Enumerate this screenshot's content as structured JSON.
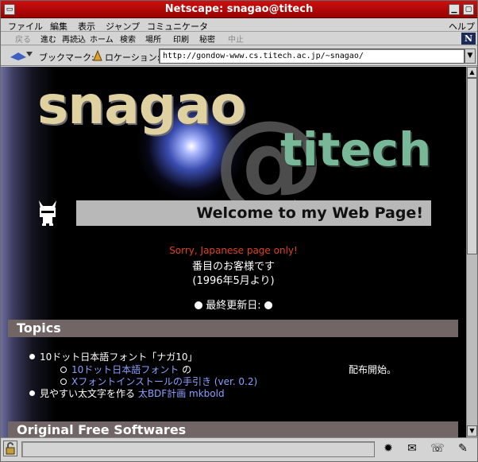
{
  "window": {
    "title": "Netscape: snagao@titech"
  },
  "menu": [
    "ファイル",
    "編集",
    "表示",
    "ジャンプ",
    "コミュニケータ",
    "ヘルプ"
  ],
  "toolbar": [
    "戻る",
    "進む",
    "再読込",
    "ホーム",
    "検索",
    "場所",
    "印刷",
    "秘密",
    "中止"
  ],
  "location": {
    "bookmarks_label": "ブックマーク:",
    "location_label": "ロケーション:",
    "url": "http://gondow-www.cs.titech.ac.jp/~snagao/"
  },
  "page": {
    "logo_main": "snagao",
    "logo_at": "@",
    "logo_titech": "titech",
    "welcome": "Welcome to my Web Page!",
    "sorry": "Sorry, Japanese page only!",
    "visitors": "番目のお客様です",
    "since": "(1996年5月より)",
    "last_updated_label": "最終更新日:",
    "topics": {
      "heading": "Topics",
      "item1": {
        "text": "10ドット日本語フォント「ナガ10」"
      },
      "sub1": {
        "link": "10ドット日本語フォント",
        "suffix": " の",
        "note": "配布開始。"
      },
      "sub2": {
        "link": "Xフォントインストールの手引き",
        "suffix": " (ver. 0.2)"
      },
      "item2": {
        "text": "見やすい太文字を作る ",
        "link": "太BDF計画 mkbold"
      }
    },
    "software": {
      "heading": "Original Free Softwares"
    }
  },
  "colors": {
    "title_bar": "#b00000",
    "link": "#8ca0ff",
    "sorry_text": "#e04020",
    "section_bar": "#716565"
  }
}
